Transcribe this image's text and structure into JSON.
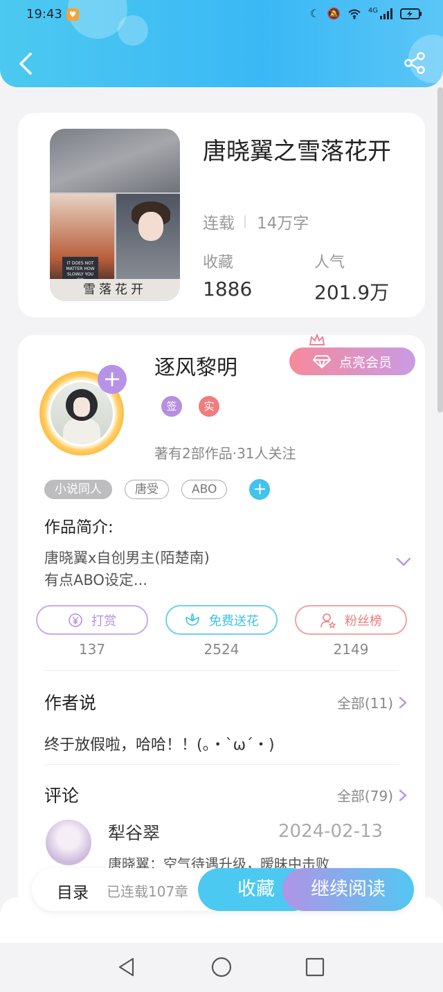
{
  "status_bar": {
    "time": "19:43",
    "network": "4G"
  },
  "book": {
    "title": "唐晓翼之雪落花开",
    "status": "连载",
    "word_count": "14万字",
    "cover_text": "雪落花开",
    "cover_sign": "IT DOES NOT MATTER HOW SLOWLY YOU GO",
    "favorites_label": "收藏",
    "favorites": "1886",
    "popularity_label": "人气",
    "popularity": "201.9万"
  },
  "author": {
    "name": "逐风黎明",
    "vip_button": "点亮会员",
    "badges": [
      "签",
      "实"
    ],
    "stats": "著有2部作品·31人关注",
    "tags": [
      "小说同人",
      "唐受",
      "ABO"
    ]
  },
  "intro": {
    "title": "作品简介:",
    "lines": [
      "唐晓翼x自创男主(陌楚南)",
      "有点ABO设定..."
    ]
  },
  "actions": [
    {
      "label": "打赏",
      "count": "137",
      "color": "#b58fe0",
      "icon": "yen-icon"
    },
    {
      "label": "免费送花",
      "count": "2524",
      "color": "#4cc4ea",
      "icon": "flower-icon"
    },
    {
      "label": "粉丝榜",
      "count": "2149",
      "color": "#ef7b7b",
      "icon": "fans-icon"
    }
  ],
  "author_says": {
    "title": "作者说",
    "all": "全部(11)",
    "text": "终于放假啦，哈哈！！(。・`ω´・)"
  },
  "comments": {
    "title": "评论",
    "all": "全部(79)",
    "items": [
      {
        "user": "犁谷翠",
        "date": "2024-02-13",
        "text": "唐晓翼：空气待遇升级，暧昧中击败"
      }
    ]
  },
  "bottom_bar": {
    "toc": "目录",
    "chapters": "已连载107章",
    "favorite": "收藏",
    "continue": "继续阅读"
  },
  "colors": {
    "accent": "#4cc9f0",
    "purple": "#b693e8"
  }
}
